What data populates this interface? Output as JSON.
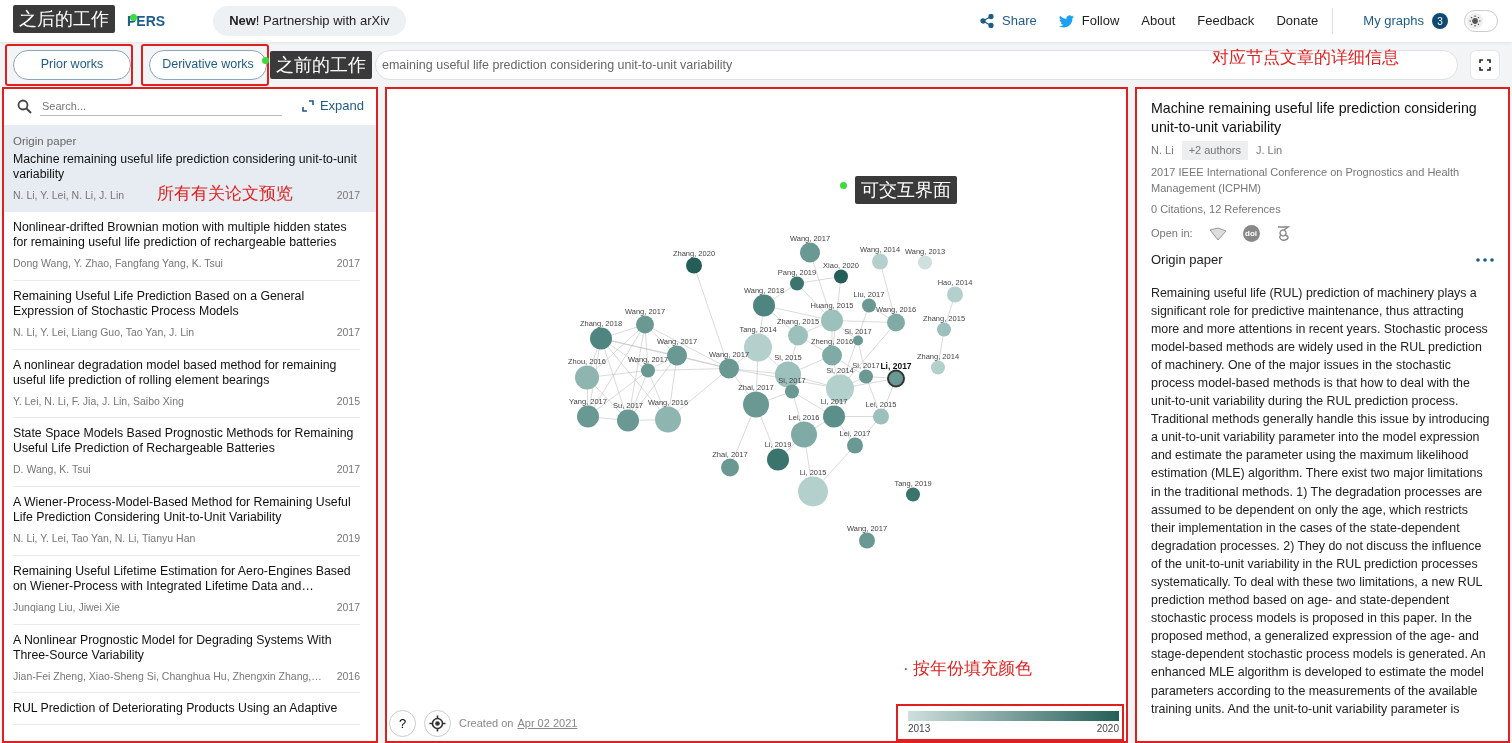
{
  "header": {
    "logo_parts": [
      "PERS"
    ],
    "announcement": "**New**! Partnership with arXiv",
    "nav": [
      {
        "label": "Share",
        "kind": "share"
      },
      {
        "label": "Follow",
        "kind": "twitter"
      },
      {
        "label": "About",
        "kind": "plain"
      },
      {
        "label": "Feedback",
        "kind": "plain"
      },
      {
        "label": "Donate",
        "kind": "plain"
      }
    ],
    "my_graphs": {
      "label": "My graphs",
      "count": "3"
    },
    "theme_toggle": {
      "on": false
    }
  },
  "toolbar": {
    "buttons": [
      {
        "label": "Prior works",
        "annotation_frame": true
      },
      {
        "label": "Derivative works",
        "annotation_frame": true
      }
    ],
    "search_value": "emaining useful life prediction considering unit-to-unit variability"
  },
  "paper_list": {
    "annotation_frame": true,
    "search": {
      "placeholder": "Search..."
    },
    "expand": "Expand",
    "items": [
      {
        "badge": "Origin paper",
        "title": "Machine remaining useful life prediction considering unit-to-unit variability",
        "authors": "N. Li, Y. Lei, N. Li, J. Lin",
        "year": "2017",
        "selected": true
      },
      {
        "title": "Nonlinear-drifted Brownian motion with multiple hidden states for remaining useful life prediction of rechargeable batteries",
        "authors": "Dong Wang, Y. Zhao, Fangfang Yang, K. Tsui",
        "year": "2017",
        "selected": false
      },
      {
        "title": "Remaining Useful Life Prediction Based on a General Expression of Stochastic Process Models",
        "authors": "N. Li, Y. Lei, Liang Guo, Tao Yan, J. Lin",
        "year": "2017",
        "selected": false
      },
      {
        "title": "A nonlinear degradation model based method for remaining useful life prediction of rolling element bearings",
        "authors": "Y. Lei, N. Li, F. Jia, J. Lin, Saibo Xing",
        "year": "2015",
        "selected": false
      },
      {
        "title": "State Space Models Based Prognostic Methods for Remaining Useful Life Prediction of Rechargeable Batteries",
        "authors": "D. Wang, K. Tsui",
        "year": "2017",
        "selected": false
      },
      {
        "title": "A Wiener-Process-Model-Based Method for Remaining Useful Life Prediction Considering Unit-to-Unit Variability",
        "authors": "N. Li, Y. Lei, Tao Yan, N. Li, Tianyu Han",
        "year": "2019",
        "selected": false
      },
      {
        "title": "Remaining Useful Lifetime Estimation for Aero-Engines Based on Wiener-Process with Integrated Lifetime Data and…",
        "authors": "Junqiang Liu, Jiwei Xie",
        "year": "2017",
        "selected": false
      },
      {
        "title": "A Nonlinear Prognostic Model for Degrading Systems With Three-Source Variability",
        "authors": "Jian-Fei Zheng, Xiao-Sheng Si, Changhua Hu, Zhengxin Zhang,…",
        "year": "2016",
        "selected": false
      },
      {
        "title": "RUL Prediction of Deteriorating Products Using an Adaptive",
        "selected": false
      }
    ]
  },
  "graph": {
    "annotation_frame": true,
    "nodes": [
      {
        "label": "Wang, 2017",
        "color": "#6a9994",
        "selected": false
      },
      {
        "label": "Zhang, 2020",
        "color": "#255e58",
        "selected": false
      },
      {
        "label": "Wang, 2014",
        "color": "#b4d0cd",
        "selected": false
      },
      {
        "label": "Wang, 2013",
        "color": "#cfe0de",
        "selected": false
      },
      {
        "label": "Pang, 2019",
        "color": "#3b736d",
        "selected": false
      },
      {
        "label": "Xiao, 2020",
        "color": "#255e58",
        "selected": false
      },
      {
        "label": "Hao, 2014",
        "color": "#b4d0cd",
        "selected": false
      },
      {
        "label": "Wang, 2018",
        "color": "#4f8580",
        "selected": false
      },
      {
        "label": "Liu, 2017",
        "color": "#6a9994",
        "selected": false
      },
      {
        "label": "Wang, 2017",
        "color": "#6a9994",
        "selected": false
      },
      {
        "label": "Huang, 2015",
        "color": "#9cc0bc",
        "selected": false
      },
      {
        "label": "Wang, 2016",
        "color": "#80aaa6",
        "selected": false
      },
      {
        "label": "Zhang, 2018",
        "color": "#4f8580",
        "selected": false
      },
      {
        "label": "Tang, 2014",
        "color": "#b4d0cd",
        "selected": false
      },
      {
        "label": "Zhang, 2015",
        "color": "#9cc0bc",
        "selected": false
      },
      {
        "label": "Si, 2017",
        "color": "#6a9994",
        "selected": false
      },
      {
        "label": "Zhang, 2015",
        "color": "#9cc0bc",
        "selected": false
      },
      {
        "label": "Wang, 2017",
        "color": "#6a9994",
        "selected": false
      },
      {
        "label": "Zheng, 2016",
        "color": "#80aaa6",
        "selected": false
      },
      {
        "label": "Zhou, 2016",
        "color": "#8fb5b1",
        "selected": false
      },
      {
        "label": "Wang, 2017",
        "color": "#6a9994",
        "selected": false
      },
      {
        "label": "Wang, 2017",
        "color": "#6a9994",
        "selected": false
      },
      {
        "label": "Si, 2015",
        "color": "#9cc0bc",
        "selected": false
      },
      {
        "label": "Zhang, 2014",
        "color": "#b4d0cd",
        "selected": false
      },
      {
        "label": "Si, 2014",
        "color": "#b4d0cd",
        "selected": false
      },
      {
        "label": "Si, 2017",
        "color": "#6a9994",
        "selected": false
      },
      {
        "label": "Li, 2017",
        "color": "#6a9994",
        "selected": true
      },
      {
        "label": "Zhai, 2017",
        "color": "#6a9994",
        "selected": false
      },
      {
        "label": "Si, 2017",
        "color": "#6a9994",
        "selected": false
      },
      {
        "label": "Yang, 2017",
        "color": "#6a9994",
        "selected": false
      },
      {
        "label": "Su, 2017",
        "color": "#6a9994",
        "selected": false
      },
      {
        "label": "Wang, 2016",
        "color": "#8fb5b1",
        "selected": false
      },
      {
        "label": "Li, 2017",
        "color": "#5b8f89",
        "selected": false
      },
      {
        "label": "Lei, 2015",
        "color": "#9cc0bc",
        "selected": false
      },
      {
        "label": "Lei, 2016",
        "color": "#80aaa6",
        "selected": false
      },
      {
        "label": "Lei, 2017",
        "color": "#6a9994",
        "selected": false
      },
      {
        "label": "Li, 2019",
        "color": "#3b736d",
        "selected": false
      },
      {
        "label": "Zhai, 2017",
        "color": "#6a9994",
        "selected": false
      },
      {
        "label": "Li, 2015",
        "color": "#b4d0cd",
        "selected": false
      },
      {
        "label": "Tang, 2019",
        "color": "#3b736d",
        "selected": false
      },
      {
        "label": "Wang, 2017",
        "color": "#6a9994",
        "selected": false
      }
    ],
    "help": "?",
    "created_prefix": "Created on",
    "created_date": "Apr 02 2021",
    "legend": {
      "annotation_frame": true,
      "start": "2013",
      "end": "2020"
    }
  },
  "details": {
    "annotation_frame": true,
    "title": "Machine remaining useful life prediction considering unit-to-unit variability",
    "authors": [
      {
        "name": "N. Li",
        "kind": "author"
      },
      {
        "name": "+2 authors",
        "kind": "more"
      },
      {
        "name": "J. Lin",
        "kind": "author"
      }
    ],
    "venue": "2017 IEEE International Conference on Prognostics and Health Management (ICPHM)",
    "stats": "0 Citations, 12 References",
    "open_in_label": "Open in:",
    "open_in": [
      {
        "kind": "gem"
      },
      {
        "kind": "doi",
        "text": "doi"
      },
      {
        "kind": "scholar"
      }
    ],
    "section": "Origin paper",
    "abstract": "Remaining useful life (RUL) prediction of machinery plays a significant role for predictive maintenance, thus attracting more and more attentions in recent years. Stochastic process model-based methods are widely used in the RUL prediction of machinery. One of the major issues in the stochastic process model-based methods is that how to deal with the unit-to-unit variability during the RUL prediction process. Traditional methods generally handle this issue by introducing a unit-to-unit variability parameter into the model expression and estimate the parameter using the maximum likelihood estimation (MLE) algorithm. There exist two major limitations in the traditional methods. 1) The degradation processes are assumed to be dependent on only the age, which restricts their implementation in the cases of the state-dependent degradation processes. 2) They do not discuss the influence of the unit-to-unit variability in the RUL prediction processes systematically. To deal with these two limitations, a new RUL prediction method based on age- and state-dependent stochastic process models is proposed in this paper. In the proposed method, a generalized expression of the age- and stage-dependent stochastic process models is generated. An enhanced MLE algorithm is developed to estimate the model parameters according to the measurements of the available training units. And the unit-to-unit variability parameter is"
  },
  "annotations": [
    {
      "kind": "dot"
    },
    {
      "kind": "dot"
    },
    {
      "kind": "dot"
    },
    {
      "kind": "dark",
      "text": "之后的工作"
    },
    {
      "kind": "dark",
      "text": "之前的工作"
    },
    {
      "kind": "dark",
      "text": "可交互界面"
    },
    {
      "kind": "red",
      "text": "对应节点文章的详细信息"
    },
    {
      "kind": "red",
      "text": "所有有关论文预览"
    },
    {
      "kind": "red",
      "text": "· 按年份填充颜色"
    }
  ]
}
